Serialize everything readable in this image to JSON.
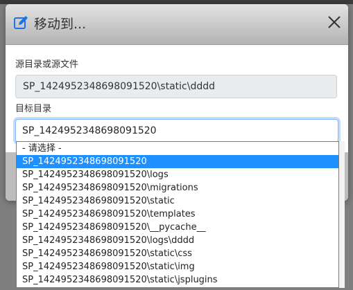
{
  "dialog": {
    "title": "移动到...",
    "icon": "edit-icon",
    "close_icon": "close-icon",
    "source_label": "源目录或源文件",
    "source_value": "SP_1424952348698091520\\static\\dddd",
    "target_label": "目标目录",
    "target_selected": "SP_1424952348698091520"
  },
  "dropdown": {
    "options": [
      "- 请选择 -",
      "SP_1424952348698091520",
      "SP_1424952348698091520\\logs",
      "SP_1424952348698091520\\migrations",
      "SP_1424952348698091520\\static",
      "SP_1424952348698091520\\templates",
      "SP_1424952348698091520\\__pycache__",
      "SP_1424952348698091520\\logs\\dddd",
      "SP_1424952348698091520\\static\\css",
      "SP_1424952348698091520\\static\\img",
      "SP_1424952348698091520\\static\\jsplugins"
    ],
    "selected_index": 1
  },
  "colors": {
    "accent": "#1e90ff",
    "icon_blue": "#1a73e8"
  }
}
